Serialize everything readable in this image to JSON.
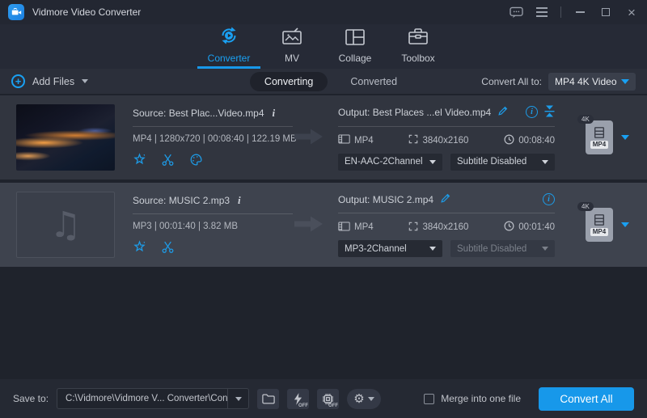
{
  "titlebar": {
    "title": "Vidmore Video Converter"
  },
  "nav": {
    "tabs": [
      {
        "label": "Converter",
        "active": true
      },
      {
        "label": "MV",
        "active": false
      },
      {
        "label": "Collage",
        "active": false
      },
      {
        "label": "Toolbox",
        "active": false
      }
    ]
  },
  "toolbar": {
    "add_files_label": "Add Files",
    "converting_tab": "Converting",
    "converted_tab": "Converted",
    "convert_all_to_label": "Convert All to:",
    "convert_all_to_value": "MP4 4K Video"
  },
  "rows": [
    {
      "source_name": "Source: Best Plac...Video.mp4",
      "source_meta": "MP4 | 1280x720 | 00:08:40 | 122.19 MB",
      "output_name": "Output: Best Places ...el Video.mp4",
      "out_format": "MP4",
      "out_resolution": "3840x2160",
      "out_duration": "00:08:40",
      "audio_track": "EN-AAC-2Channel",
      "subtitle": "Subtitle Disabled",
      "format_badge": "4K",
      "format_label": "MP4"
    },
    {
      "source_name": "Source: MUSIC 2.mp3",
      "source_meta": "MP3 | 00:01:40 | 3.82 MB",
      "output_name": "Output: MUSIC 2.mp4",
      "out_format": "MP4",
      "out_resolution": "3840x2160",
      "out_duration": "00:01:40",
      "audio_track": "MP3-2Channel",
      "subtitle": "Subtitle Disabled",
      "format_badge": "4K",
      "format_label": "MP4"
    }
  ],
  "bottombar": {
    "save_to_label": "Save to:",
    "path": "C:\\Vidmore\\Vidmore V... Converter\\Converted",
    "off_label": "OFF",
    "merge_label": "Merge into one file",
    "convert_all_label": "Convert All"
  },
  "icons": {
    "close": "×",
    "gear": "⚙",
    "music_note": "♫",
    "plus": "+",
    "info_italic": "i",
    "info_circle": "i"
  },
  "colors": {
    "accent_blue": "#19a0f2",
    "convert_button_blue": "#1798ea",
    "row_icon_blue": "#1d9ce8",
    "row1_bg": "#31353f",
    "row2_bg": "#3e434e",
    "titlebar_bg": "#232732"
  }
}
